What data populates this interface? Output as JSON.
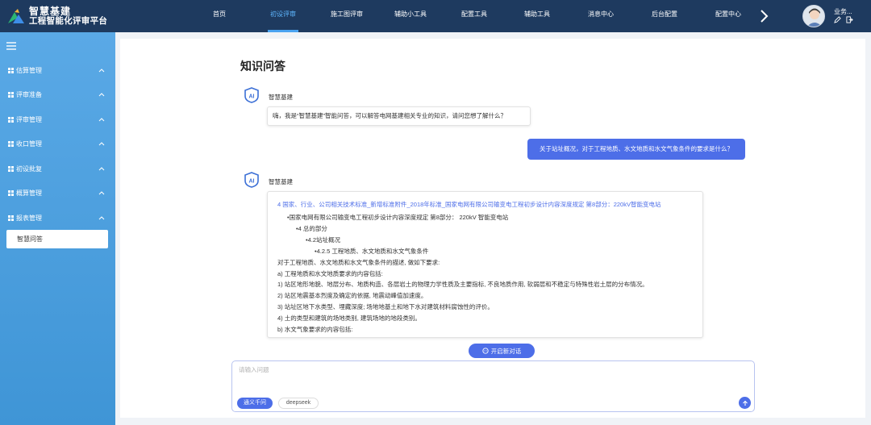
{
  "app": {
    "brand_line1": "智慧基建",
    "brand_line2": "工程智能化评审平台"
  },
  "nav": {
    "items": [
      {
        "label": "首页"
      },
      {
        "label": "初设评审",
        "active": true
      },
      {
        "label": "施工图评审"
      },
      {
        "label": "辅助小工具"
      },
      {
        "label": "配置工具"
      },
      {
        "label": "辅助工具"
      },
      {
        "label": "消息中心"
      },
      {
        "label": "后台配置"
      },
      {
        "label": "配置中心"
      }
    ]
  },
  "user": {
    "name": "业务..."
  },
  "sidebar": {
    "groups": [
      {
        "label": "估算管理"
      },
      {
        "label": "评审准备"
      },
      {
        "label": "评审管理"
      },
      {
        "label": "收口管理"
      },
      {
        "label": "初设批复"
      },
      {
        "label": "概算管理"
      },
      {
        "label": "报表管理"
      }
    ],
    "active_sub": "智慧问答"
  },
  "page": {
    "title": "知识问答"
  },
  "chat": {
    "bot_name": "智慧基建",
    "greeting": "嗨，我是“智慧基建”智能问答，可以解答电网基建相关专业的知识，请问您想了解什么？",
    "user_question": "关于站址概况，对于工程地质、水文地质和水文气象条件的要求是什么？",
    "answer": {
      "source": "4 国家、行业、公司相关技术标准_新增标准附件_2018年标准_国家电网有限公司输变电工程初步设计内容深度规定 第8部分：220kV智能变电站",
      "lines": [
        "•国家电网有限公司输变电工程初步设计内容深度规定 第8部分： 220kV 智能变电站",
        "•4 总的部分",
        "•4.2站址概况",
        "•4.2.5 工程地质、水文地质和水文气象条件",
        "对于工程地质、水文地质和水文气象条件的描述, 做如下要求:",
        "a) 工程地质和水文地质要求的内容包括:",
        "1) 站区地形地貌、地层分布、地质构造、各层岩土的物理力学性质及主要指标, 不良地质作用, 软弱层和不稳定与特殊性岩土层的分布情况。",
        "2) 站区地震基本烈度及确定的依据, 地震动峰值加速度。",
        "3) 站址区地下水类型、埋藏深度; 场地地基土和地下水对建筑材料腐蚀性的评价。",
        "4) 土的类型和建筑的场地类别, 建筑场地的地段类别。",
        "b) 水文气象要求的内容包括:"
      ]
    },
    "new_chat_label": "开启新对话"
  },
  "composer": {
    "placeholder": "请输入问题",
    "model_a": "通义千问",
    "model_b": "deepseek"
  },
  "colors": {
    "topbar": "#1e3a5f",
    "sidebar": "#4a9fe0",
    "accent": "#4d6ee8",
    "nav_active": "#5fb7ff"
  }
}
